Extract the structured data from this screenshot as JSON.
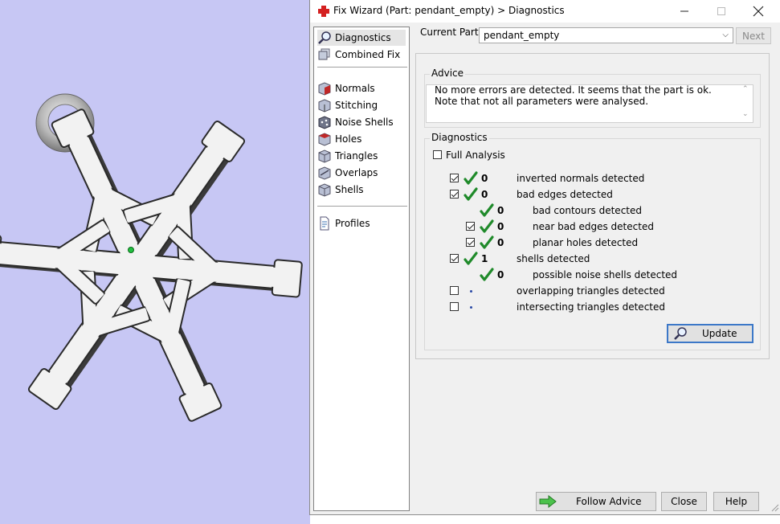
{
  "window": {
    "title": "Fix Wizard (Part: pendant_empty) > Diagnostics",
    "app_icon": "red-cross-icon"
  },
  "nav": {
    "items": [
      {
        "label": "Diagnostics",
        "icon": "magnifier-icon"
      },
      {
        "label": "Combined Fix",
        "icon": "combined-fix-icon"
      },
      {
        "label": "Normals",
        "icon": "normals-cube-icon"
      },
      {
        "label": "Stitching",
        "icon": "stitching-cube-icon"
      },
      {
        "label": "Noise Shells",
        "icon": "noise-shells-icon"
      },
      {
        "label": "Holes",
        "icon": "holes-cube-icon"
      },
      {
        "label": "Triangles",
        "icon": "triangles-cube-icon"
      },
      {
        "label": "Overlaps",
        "icon": "overlaps-cube-icon"
      },
      {
        "label": "Shells",
        "icon": "shells-cube-icon"
      },
      {
        "label": "Profiles",
        "icon": "profile-document-icon"
      }
    ],
    "selected": "Diagnostics"
  },
  "current_part": {
    "label": "Current Part:",
    "value": "pendant_empty"
  },
  "next_label": "Next",
  "advice": {
    "title": "Advice",
    "text": "No more errors are detected. It seems that the part is ok. Note that not all parameters were analysed."
  },
  "diagnostics": {
    "title": "Diagnostics",
    "full_analysis": {
      "label": "Full Analysis",
      "checked": false
    },
    "rows": [
      {
        "checked": true,
        "status": "ok",
        "count": "0",
        "label": "inverted normals detected"
      },
      {
        "checked": true,
        "status": "ok",
        "count": "0",
        "label": "bad edges detected"
      },
      {
        "checked": null,
        "status": "ok",
        "count": "0",
        "label": "bad contours detected"
      },
      {
        "checked": true,
        "status": "ok",
        "count": "0",
        "label": "near bad edges detected"
      },
      {
        "checked": true,
        "status": "ok",
        "count": "0",
        "label": "planar holes detected"
      },
      {
        "checked": true,
        "status": "ok",
        "count": "1",
        "label": "shells detected"
      },
      {
        "checked": null,
        "status": "ok",
        "count": "0",
        "label": "possible noise shells detected"
      },
      {
        "checked": false,
        "status": "not-run",
        "count": "",
        "label": "overlapping triangles detected"
      },
      {
        "checked": false,
        "status": "not-run",
        "count": "",
        "label": "intersecting triangles detected"
      }
    ],
    "update_label": "Update"
  },
  "footer": {
    "follow_advice": "Follow Advice",
    "close": "Close",
    "help": "Help"
  },
  "colors": {
    "viewport_bg": "#c7c7f4",
    "check_green": "#1f8a2a",
    "accent": "#3c78c8"
  }
}
